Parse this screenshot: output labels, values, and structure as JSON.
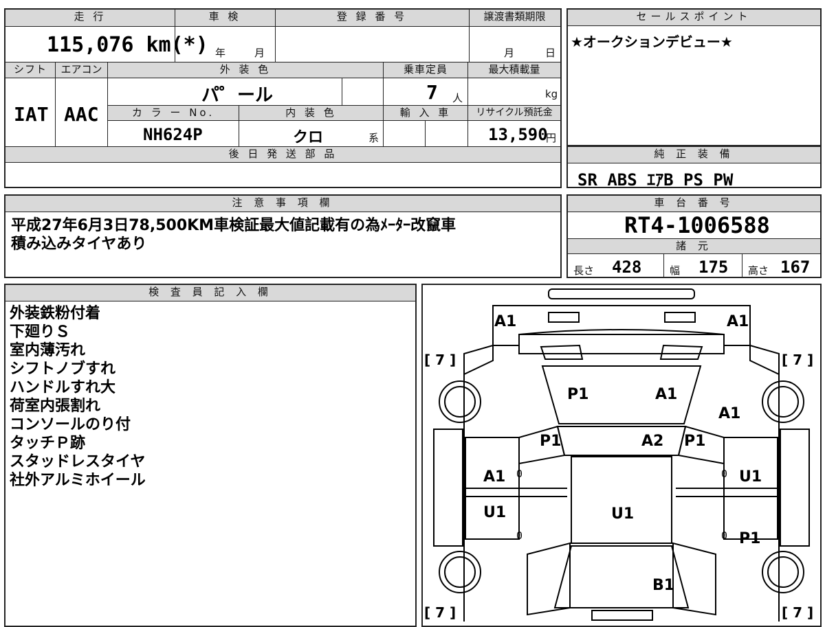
{
  "top_grid": {
    "mileage_header": "走 行",
    "mileage_value": "115,076 km(*)",
    "inspection_header": "車 検",
    "inspection_year_unit": "年",
    "inspection_month_unit": "月",
    "registration_header": "登 録 番 号",
    "transfer_deadline_header": "譲渡書類期限",
    "transfer_month_unit": "月",
    "transfer_day_unit": "日",
    "shift_header": "シフト",
    "shift_value": "IAT",
    "aircon_header": "エアコン",
    "aircon_value": "AAC",
    "exterior_color_header": "外 装 色",
    "exterior_color_value": "パ゜ール",
    "capacity_header": "乗車定員",
    "capacity_value": "7",
    "capacity_unit": "人",
    "max_load_header": "最大積載量",
    "max_load_unit": "kg",
    "color_no_header": "カ ラ ー No.",
    "color_no_value": "NH624P",
    "interior_color_header": "内 装 色",
    "interior_color_value": "クロ",
    "interior_color_suffix": "系",
    "import_header": "輸 入 車",
    "recycle_header": "リサイクル預託金",
    "recycle_value": "13,590",
    "recycle_unit": "円",
    "later_parts_header": "後 日 発 送 部 品"
  },
  "sales_points": {
    "header": "セールスポイント",
    "text": "★オークションデビュー★"
  },
  "genuine_equipment": {
    "header": "純 正 装 備",
    "items": "SR ABS ｴｱB PS PW"
  },
  "notes": {
    "header": "注 意 事 項 欄",
    "lines": [
      "平成27年6月3日78,500KM車検証最大値記載有の為ﾒｰﾀｰ改竄車",
      "積み込みタイヤあり"
    ]
  },
  "chassis": {
    "header": "車 台 番 号",
    "value": "RT4-1006588"
  },
  "specs": {
    "header": "諸 元",
    "length_label": "長さ",
    "length_value": "428",
    "width_label": "幅",
    "width_value": "175",
    "height_label": "高さ",
    "height_value": "167"
  },
  "inspector": {
    "header": "検 査 員 記 入 欄",
    "lines": [
      "外装鉄粉付着",
      "下廻りＳ",
      "室内薄汚れ",
      "シフトノブすれ",
      "ハンドルすれ大",
      "荷室内張割れ",
      "コンソールのり付",
      "タッチＰ跡",
      "スタッドレスタイヤ",
      "社外アルミホイール"
    ]
  },
  "diagram": {
    "labels": {
      "a1_front_left": "A1",
      "a1_front_right": "A1",
      "p1_hood_left": "P1",
      "a1_hood_right": "A1",
      "a1_right_fender": "A1",
      "p1_left_pillar": "P1",
      "a2_windshield": "A2",
      "p1_right_pillar": "P1",
      "a1_left_front_door": "A1",
      "u1_right_front_door": "U1",
      "u1_roof": "U1",
      "u1_left_rear_door": "U1",
      "p1_right_rear_door": "P1",
      "b1_rear": "B1",
      "tire_fl": "[ 7 ]",
      "tire_fr": "[ 7 ]",
      "tire_rl": "[ 7 ]",
      "tire_rr": "[ 7 ]",
      "zero_1": "0",
      "zero_2": "0",
      "zero_3": "0",
      "zero_4": "0"
    }
  }
}
